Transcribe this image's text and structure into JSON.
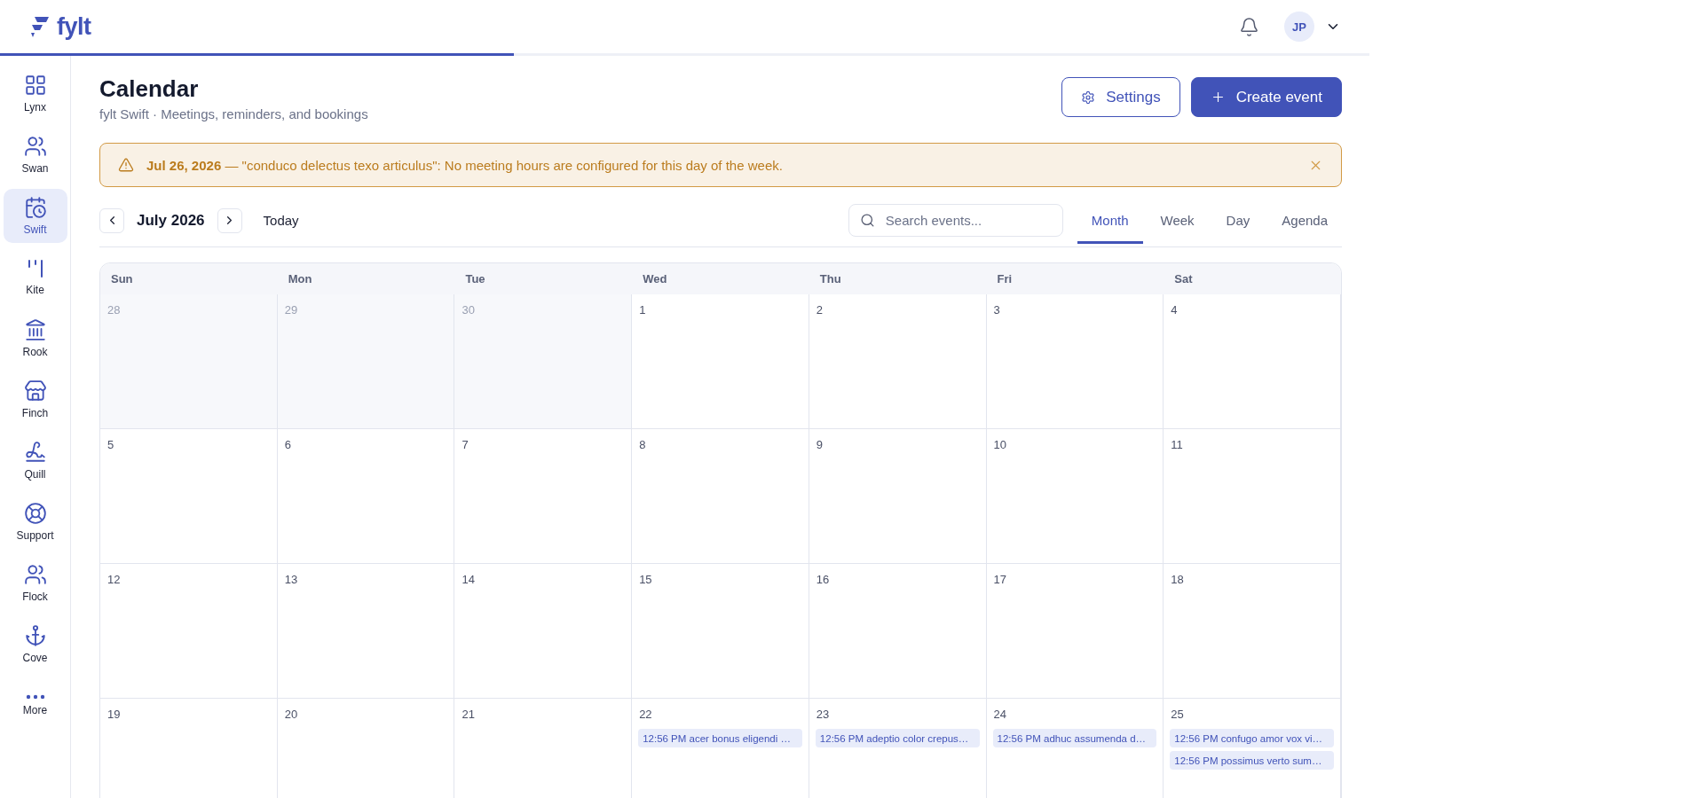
{
  "header": {
    "logo": "fylt",
    "loading": {
      "level": 0.375
    },
    "avatar": "JP"
  },
  "sidebar": {
    "items": [
      {
        "label": "Lynx",
        "selected": false
      },
      {
        "label": "Swan",
        "selected": false
      },
      {
        "label": "Swift",
        "selected": true
      },
      {
        "label": "Kite",
        "selected": false
      },
      {
        "label": "Rook",
        "selected": false
      },
      {
        "label": "Finch",
        "selected": false
      },
      {
        "label": "Quill",
        "selected": false
      },
      {
        "label": "Support",
        "selected": false
      },
      {
        "label": "Flock",
        "selected": false
      },
      {
        "label": "Cove",
        "selected": false
      },
      {
        "label": "More",
        "selected": false
      }
    ]
  },
  "page": {
    "title": "Calendar",
    "subtitle": "fylt Swift · Meetings, reminders, and bookings",
    "buttons": [
      {
        "kind": "outline",
        "label": "Settings"
      },
      {
        "kind": "primary",
        "label": "Create event"
      }
    ]
  },
  "alert": {
    "text": "**Jul 26, 2026** — \"conduco delectus texo articulus\": No meeting hours are configured for this day of the week."
  },
  "toolbar": {
    "month": "July 2026",
    "today": "Today",
    "search": {
      "placeholder": "Search events..."
    },
    "views": [
      {
        "label": "Month",
        "selected": true
      },
      {
        "label": "Week",
        "selected": false
      },
      {
        "label": "Day",
        "selected": false
      },
      {
        "label": "Agenda",
        "selected": false
      }
    ]
  },
  "calendar": {
    "weekdays": [
      "Sun",
      "Mon",
      "Tue",
      "Wed",
      "Thu",
      "Fri",
      "Sat"
    ],
    "weeks": [
      [
        {
          "day": "28",
          "muted": true
        },
        {
          "day": "29",
          "muted": true
        },
        {
          "day": "30",
          "muted": true
        },
        {
          "day": "1",
          "muted": false
        },
        {
          "day": "2",
          "muted": false
        },
        {
          "day": "3",
          "muted": false
        },
        {
          "day": "4",
          "muted": false
        }
      ],
      [
        {
          "day": "5",
          "muted": false
        },
        {
          "day": "6",
          "muted": false
        },
        {
          "day": "7",
          "muted": false
        },
        {
          "day": "8",
          "muted": false
        },
        {
          "day": "9",
          "muted": false
        },
        {
          "day": "10",
          "muted": false
        },
        {
          "day": "11",
          "muted": false
        }
      ],
      [
        {
          "day": "12",
          "muted": false
        },
        {
          "day": "13",
          "muted": false
        },
        {
          "day": "14",
          "muted": false
        },
        {
          "day": "15",
          "muted": false
        },
        {
          "day": "16",
          "muted": false
        },
        {
          "day": "17",
          "muted": false
        },
        {
          "day": "18",
          "muted": false
        }
      ],
      [
        {
          "day": "19",
          "muted": false
        },
        {
          "day": "20",
          "muted": false
        },
        {
          "day": "21",
          "muted": false
        },
        {
          "day": "22",
          "muted": false,
          "events": [
            "12:56 PM acer bonus eligendi …"
          ]
        },
        {
          "day": "23",
          "muted": false,
          "events": [
            "12:56 PM adeptio color crepus…"
          ]
        },
        {
          "day": "24",
          "muted": false,
          "events": [
            "12:56 PM adhuc assumenda d…"
          ]
        },
        {
          "day": "25",
          "muted": false,
          "events": [
            "12:56 PM confugo amor vox vi…",
            "12:56 PM possimus verto sum…"
          ]
        }
      ]
    ]
  }
}
